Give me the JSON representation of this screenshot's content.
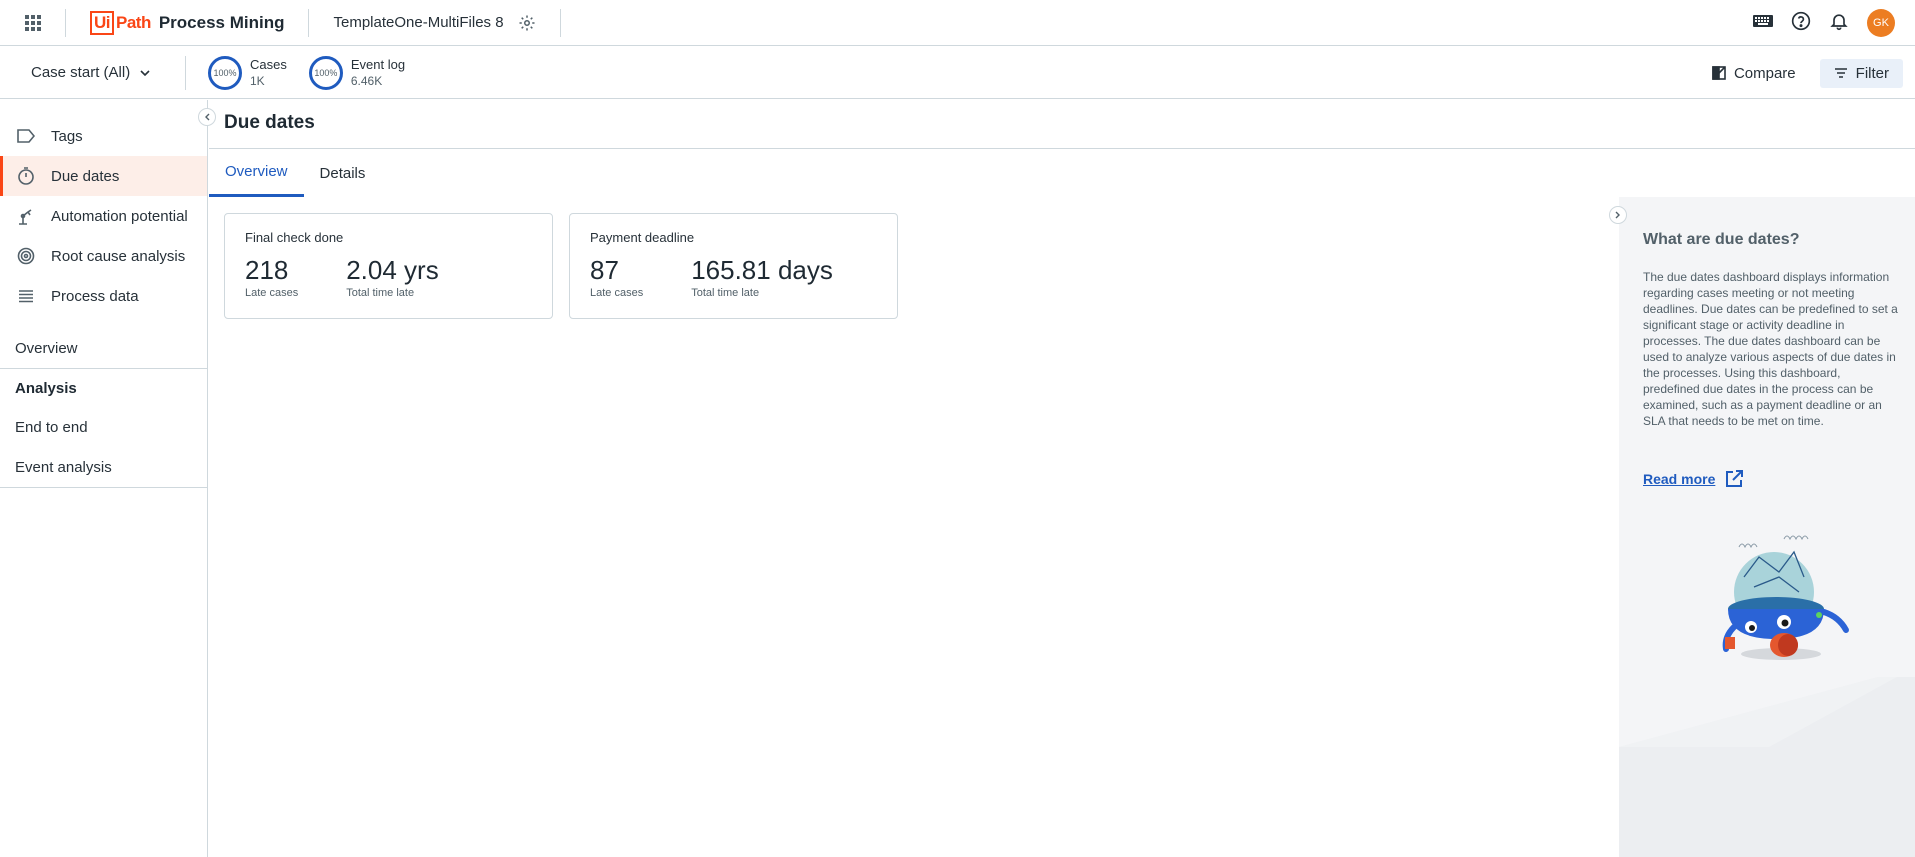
{
  "header": {
    "logo_box": "Ui",
    "logo_path": "Path",
    "product": "Process Mining",
    "app_name": "TemplateOne-MultiFiles 8",
    "avatar_initials": "GK"
  },
  "filterbar": {
    "case_start": "Case start (All)",
    "metrics": [
      {
        "label": "Cases",
        "value": "1K",
        "percent": "100%"
      },
      {
        "label": "Event log",
        "value": "6.46K",
        "percent": "100%"
      }
    ],
    "compare_label": "Compare",
    "filter_label": "Filter"
  },
  "sidebar": {
    "items": [
      {
        "label": "Tags",
        "icon": "tag-icon"
      },
      {
        "label": "Due dates",
        "icon": "timer-icon",
        "active": true
      },
      {
        "label": "Automation potential",
        "icon": "robot-arm-icon"
      },
      {
        "label": "Root cause analysis",
        "icon": "target-icon"
      },
      {
        "label": "Process data",
        "icon": "list-icon"
      }
    ],
    "overview_label": "Overview",
    "analysis_header": "Analysis",
    "analysis_items": [
      {
        "label": "End to end"
      },
      {
        "label": "Event analysis"
      }
    ]
  },
  "main": {
    "title": "Due dates",
    "tabs": [
      {
        "label": "Overview",
        "active": true
      },
      {
        "label": "Details"
      }
    ],
    "cards": [
      {
        "title": "Final check done",
        "late_cases": "218",
        "late_cases_label": "Late cases",
        "total_time": "2.04 yrs",
        "total_time_label": "Total time late"
      },
      {
        "title": "Payment deadline",
        "late_cases": "87",
        "late_cases_label": "Late cases",
        "total_time": "165.81 days",
        "total_time_label": "Total time late"
      }
    ]
  },
  "info_panel": {
    "title": "What are due dates?",
    "text": "The due dates dashboard displays information regarding cases meeting or not meeting deadlines. Due dates can be predefined to set a significant stage or activity deadline in processes. The due dates dashboard can be used to analyze various aspects of due dates in the processes. Using this dashboard, predefined due dates in the process can be examined, such as a payment deadline or an SLA that needs to be met on time.",
    "read_more": "Read more"
  },
  "colors": {
    "brand": "#fa4616",
    "accent": "#1f5bbf",
    "active_bg": "#fdeee8",
    "avatar": "#ec7d22"
  }
}
